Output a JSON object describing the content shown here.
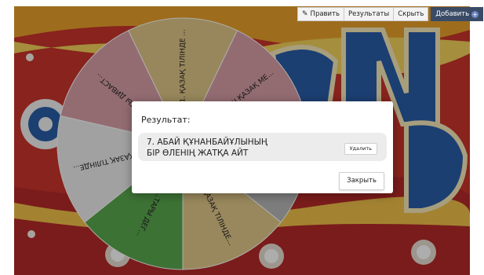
{
  "toolbar": {
    "edit_label": "Править",
    "results_label": "Результаты",
    "hide_label": "Скрыть",
    "add_label": "Добавить"
  },
  "wheel": {
    "segments": [
      {
        "label": "1. ҚАЗАҚ ТІЛІНДЕ ...",
        "color": "#e0c888"
      },
      {
        "label": "...ЛГАШ ҚАЗАҚ МЕ...",
        "color": "#d9a0a8"
      },
      {
        "label": "...ОЛЫН...",
        "color": "#b8b8b8"
      },
      {
        "label": "...ҚАЗАҚ ТІЛІНДЕ...",
        "color": "#e2c98a"
      },
      {
        "label": "...ТАРЫ ДЕГ...",
        "color": "#5aa84e"
      },
      {
        "label": "...ҚАЗАҚ ТІЛІНДЕ...",
        "color": "#eeeeee"
      },
      {
        "label": "...ЕСТЫ ДИВАСТ...",
        "color": "#d9a0a8"
      }
    ]
  },
  "modal": {
    "title": "Результат:",
    "result_line1": "7. АБАЙ ҚҰНАНБАЙҰЛЫНЫҢ",
    "result_line2": "БІР ӨЛЕНІҢ ЖАТҚА АЙТ",
    "delete_label": "Удалить",
    "close_label": "Закрыть"
  }
}
